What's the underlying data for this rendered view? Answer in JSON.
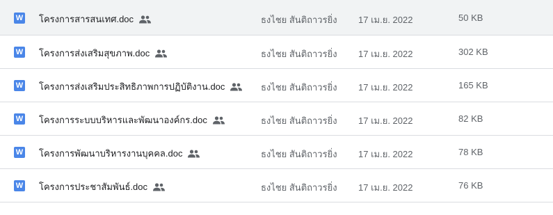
{
  "files": [
    {
      "icon": "word-doc-icon",
      "icon_letter": "W",
      "name": "โครงการสารสนเทศ.doc",
      "shared": true,
      "owner": "ธงไชย สันติถาวรยิ่ง",
      "modified": "17 เม.ย. 2022",
      "size": "50 KB"
    },
    {
      "icon": "word-doc-icon",
      "icon_letter": "W",
      "name": "โครงการส่งเสริมสุขภาพ.doc",
      "shared": true,
      "owner": "ธงไชย สันติถาวรยิ่ง",
      "modified": "17 เม.ย. 2022",
      "size": "302 KB"
    },
    {
      "icon": "word-doc-icon",
      "icon_letter": "W",
      "name": "โครงการส่งเสริมประสิทธิภาพการปฏิบัติงาน.doc",
      "shared": true,
      "owner": "ธงไชย สันติถาวรยิ่ง",
      "modified": "17 เม.ย. 2022",
      "size": "165 KB"
    },
    {
      "icon": "word-doc-icon",
      "icon_letter": "W",
      "name": "โครงการระบบบริหารและพัฒนาองค์กร.doc",
      "shared": true,
      "owner": "ธงไชย สันติถาวรยิ่ง",
      "modified": "17 เม.ย. 2022",
      "size": "82 KB"
    },
    {
      "icon": "word-doc-icon",
      "icon_letter": "W",
      "name": "โครงการพัฒนาบริหารงานบุคคล.doc",
      "shared": true,
      "owner": "ธงไชย สันติถาวรยิ่ง",
      "modified": "17 เม.ย. 2022",
      "size": "78 KB"
    },
    {
      "icon": "word-doc-icon",
      "icon_letter": "W",
      "name": "โครงการประชาสัมพันธ์.doc",
      "shared": true,
      "owner": "ธงไชย สันติถาวรยิ่ง",
      "modified": "17 เม.ย. 2022",
      "size": "76 KB"
    }
  ],
  "colors": {
    "word_icon": "#4a86e8",
    "divider": "#dadce0",
    "primary_text": "#202124",
    "secondary_text": "#5f6368"
  }
}
